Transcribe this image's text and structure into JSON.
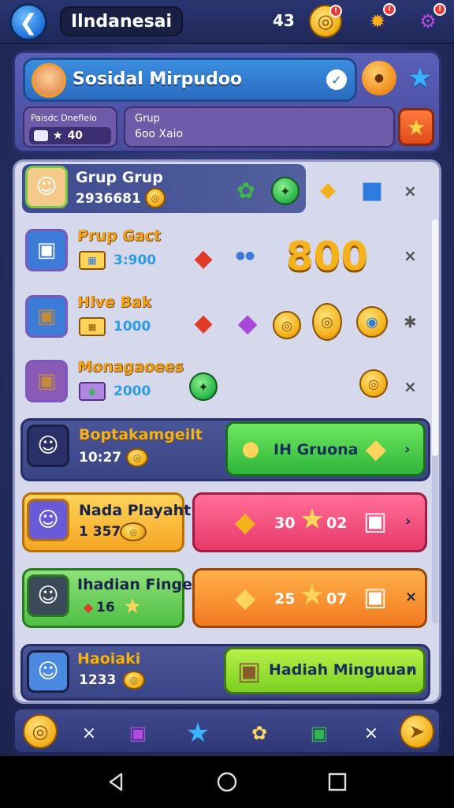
{
  "top_bar": {
    "back_icon": "back-arrow-icon",
    "title": "Ilndanesai",
    "count": "43",
    "icons": [
      "coin-icon",
      "gear-icon",
      "settings-icon"
    ],
    "accent": "#2a3470"
  },
  "profile": {
    "name": "Sosidal Mirpudoo",
    "stat_label": "Paisdc Dneflelo",
    "stat_value": "40",
    "group_label": "Grup",
    "group_value": "6oo Xaio"
  },
  "rows": [
    {
      "title": "Grup Grup",
      "sub": "2936681",
      "style": "highlight"
    },
    {
      "title": "Prup Gact",
      "sub": "3:900",
      "big_text": "800"
    },
    {
      "title": "Hlve Bak",
      "sub": "1000"
    },
    {
      "title": "Monagaoees",
      "sub": "2000"
    }
  ],
  "cards": [
    {
      "title": "Boptakamgeilt",
      "sub": "10:27",
      "button": "IH Gruona"
    },
    {
      "title": "Nada Playaht",
      "sub": "1 357",
      "reward_left": "30",
      "reward_right": "02"
    },
    {
      "title": "Ihadian Fingealt",
      "sub": "16",
      "reward_left": "25",
      "reward_right": "07"
    },
    {
      "title": "Haoiaki",
      "sub": "1233",
      "button": "Hadiah Minguuan"
    }
  ],
  "colors": {
    "green_button": "#2fb53a",
    "pink_button": "#e8386a",
    "orange_button": "#f27a20",
    "gold": "#f2b21c"
  }
}
